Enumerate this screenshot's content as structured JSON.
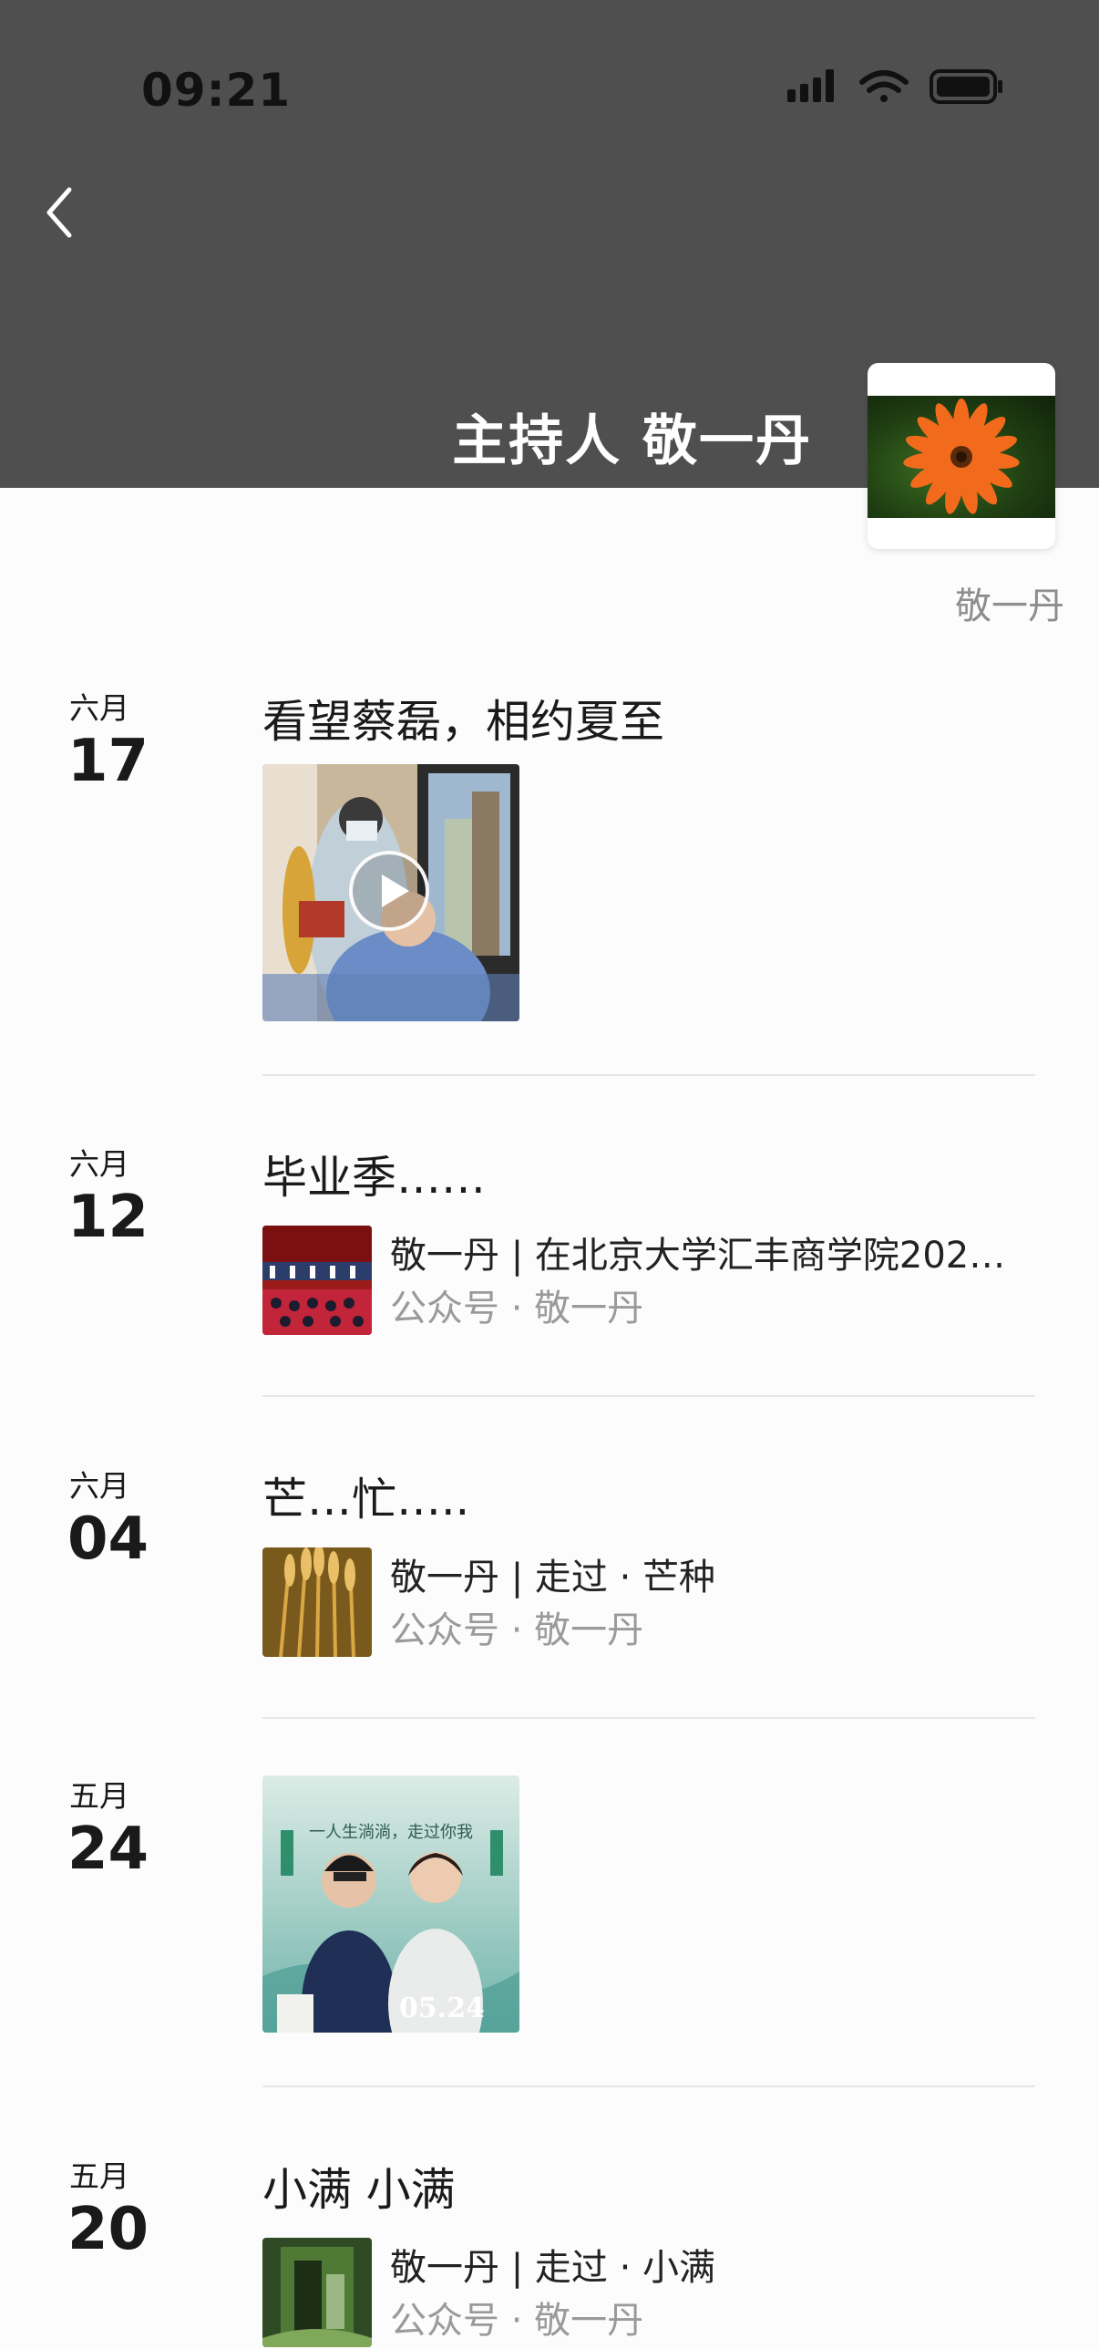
{
  "status_bar": {
    "time": "09:21"
  },
  "cover": {
    "title": "主持人 敬一丹",
    "owner_name": "敬一丹"
  },
  "posts": [
    {
      "month": "六月",
      "day": "17",
      "title": "看望蔡磊，相约夏至",
      "media": "video"
    },
    {
      "month": "六月",
      "day": "12",
      "title": "毕业季……",
      "share": {
        "title": "敬一丹 | 在北京大学汇丰商学院202…",
        "source": "公众号 · 敬一丹"
      }
    },
    {
      "month": "六月",
      "day": "04",
      "title": "芒…忙…..",
      "share": {
        "title": "敬一丹 | 走过 · 芒种",
        "source": "公众号 · 敬一丹"
      }
    },
    {
      "month": "五月",
      "day": "24",
      "media": "poster",
      "poster": {
        "tagline": "一人生淌淌，走过你我",
        "date": "05.24"
      }
    },
    {
      "month": "五月",
      "day": "20",
      "title": "小满 小满",
      "share": {
        "title": "敬一丹 | 走过 · 小满",
        "source": "公众号 · 敬一丹"
      }
    }
  ],
  "colors": {
    "cover_bg": "#4f4f4f",
    "page_bg": "#fcfcfc",
    "muted_text": "#9a9a9a"
  }
}
